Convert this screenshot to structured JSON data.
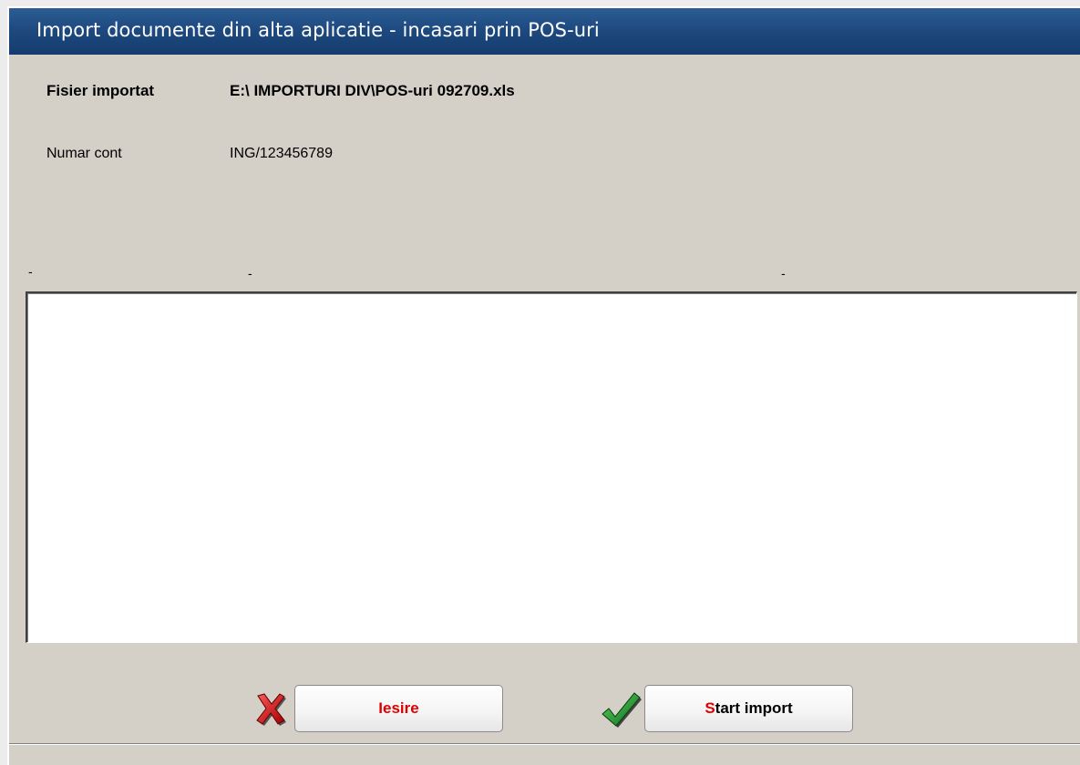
{
  "window": {
    "title": "Import documente din alta aplicatie - incasari prin POS-uri"
  },
  "fields": {
    "file_label": "Fisier importat",
    "file_value": "E:\\ IMPORTURI DIV\\POS-uri 092709.xls",
    "account_label": "Numar cont",
    "account_value": "ING/123456789"
  },
  "column_headers": [
    "-",
    "-",
    "-"
  ],
  "list": {
    "rows": []
  },
  "buttons": {
    "exit": {
      "hotkey": "I",
      "rest": "esire",
      "icon": "red-x-icon"
    },
    "start": {
      "hotkey": "S",
      "rest": "tart import",
      "icon": "green-check-icon"
    }
  },
  "colors": {
    "titlebar": "#1e4a80",
    "hotkey": "#e00000",
    "window_bg": "#d4d0c8"
  }
}
